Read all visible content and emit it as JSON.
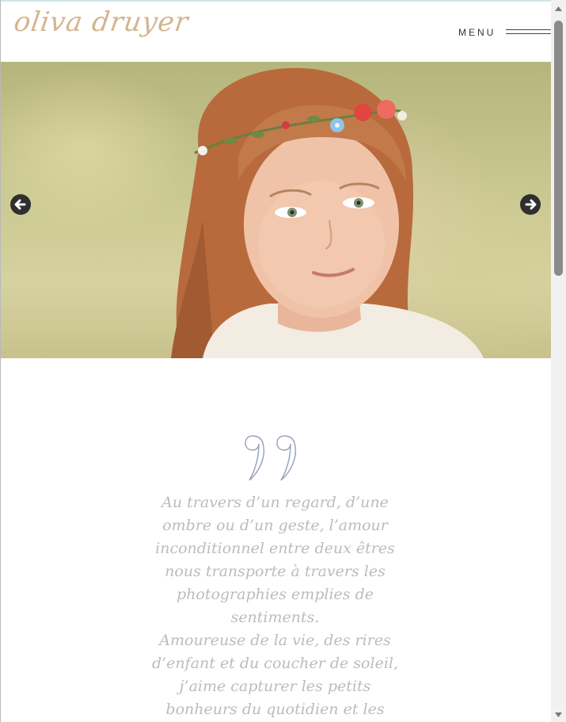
{
  "header": {
    "logo": "oliva druyer",
    "menu_label": "MENU"
  },
  "slider": {
    "prev_icon": "arrow-left-icon",
    "next_icon": "arrow-right-icon"
  },
  "quote": {
    "icon": "quote-marks-icon",
    "paragraphs": [
      "Au travers d’un regard, d’une ombre ou d’un geste, l’amour inconditionnel entre deux êtres nous transporte à travers les photographies emplies de sentiments.",
      "Amoureuse de la vie, des rires d’enfant et du coucher de soleil, j’aime capturer les petits bonheurs du quotidien et les"
    ]
  },
  "colors": {
    "logo": "#d4b58f",
    "quote_text": "#bcbcbc",
    "quote_icon": "#9aa4c0"
  }
}
